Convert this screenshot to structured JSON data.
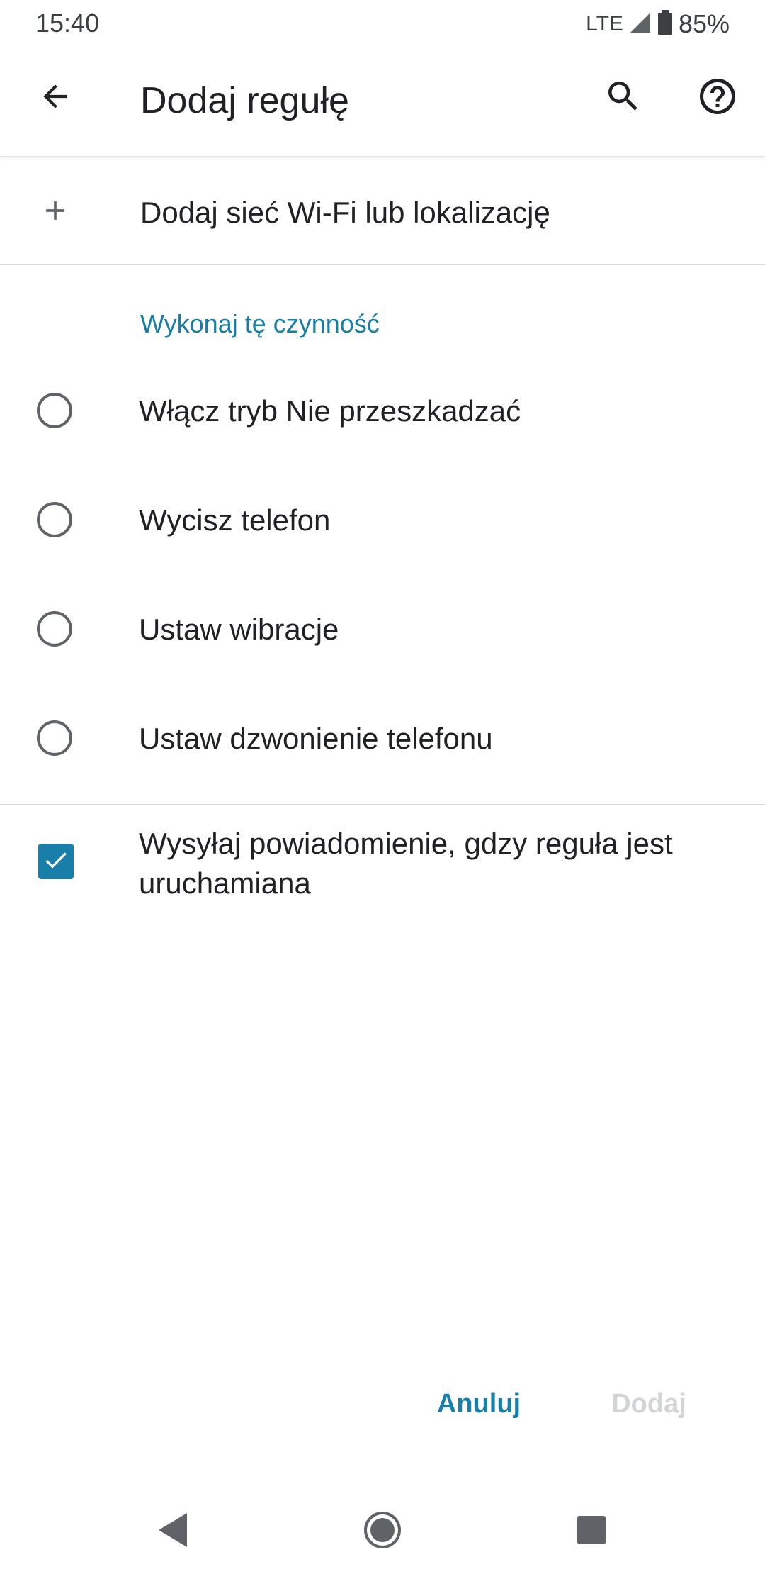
{
  "status_bar": {
    "time": "15:40",
    "network": "LTE",
    "battery": "85%"
  },
  "app_bar": {
    "title": "Dodaj regułę",
    "icons": [
      "back-arrow-icon",
      "search-icon",
      "help-icon"
    ]
  },
  "add_location": {
    "icon": "plus-icon",
    "label": "Dodaj sieć Wi-Fi lub lokalizację"
  },
  "actions_section": {
    "header": "Wykonaj tę czynność",
    "options": [
      {
        "label": "Włącz tryb Nie przeszkadzać",
        "selected": false
      },
      {
        "label": "Wycisz telefon",
        "selected": false
      },
      {
        "label": "Ustaw wibracje",
        "selected": false
      },
      {
        "label": "Ustaw dzwonienie telefonu",
        "selected": false
      }
    ]
  },
  "notification_option": {
    "label": "Wysyłaj powiadomienie, gdzy reguła jest uruchamiana",
    "checked": true
  },
  "dialog_buttons": {
    "cancel": "Anuluj",
    "add": "Dodaj",
    "add_enabled": false
  },
  "colors": {
    "accent": "#1a7fa8",
    "disabled": "#d2d4d6",
    "text": "#202124",
    "icon": "#5f6368"
  },
  "nav_bar": {
    "icons": [
      "nav-back-icon",
      "nav-home-icon",
      "nav-recents-icon"
    ]
  }
}
